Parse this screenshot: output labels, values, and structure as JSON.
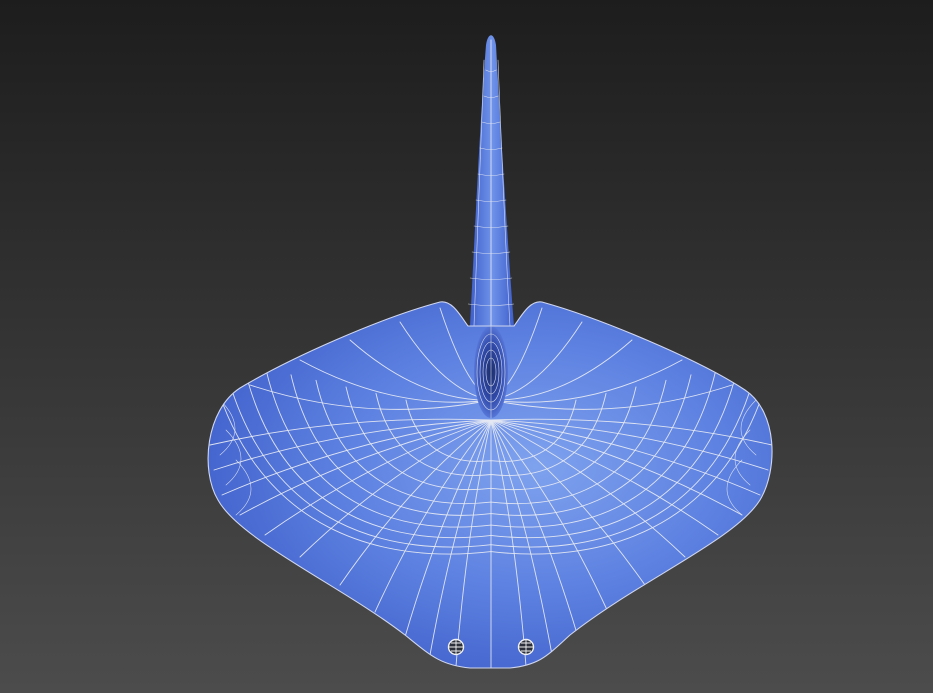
{
  "viewport": {
    "mode": "perspective",
    "shading": "smooth-plus-wireframe",
    "background_top": "#1d1d1d",
    "background_bottom": "#4c4c4c"
  },
  "model": {
    "kind": "stingray-mesh",
    "surface_color": "#5b7fe0",
    "surface_highlight": "#7fa2ee",
    "surface_shadow": "#3e5ec9",
    "wire_color": "#e6e9f2",
    "icons": [
      "eye-marker-icon",
      "eye-marker-icon"
    ]
  }
}
